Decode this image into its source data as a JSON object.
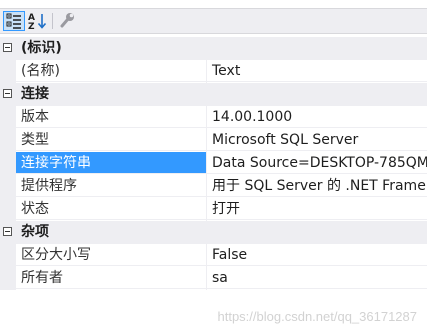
{
  "toolbar": {
    "categorized_icon": "categorized-view-icon",
    "alphabetical_icon": "alphabetical-sort-icon",
    "properties_icon": "wrench-icon"
  },
  "categories": {
    "identity": {
      "label": "(标识)",
      "rows": [
        {
          "name": "(名称)",
          "value": "Text"
        }
      ]
    },
    "connection": {
      "label": "连接",
      "rows": [
        {
          "name": "版本",
          "value": "14.00.1000"
        },
        {
          "name": "类型",
          "value": "Microsoft SQL Server"
        },
        {
          "name": "连接字符串",
          "value": "Data Source=DESKTOP-785QM"
        },
        {
          "name": "提供程序",
          "value": "用于 SQL Server 的 .NET Frame"
        },
        {
          "name": "状态",
          "value": "打开"
        }
      ]
    },
    "misc": {
      "label": "杂项",
      "rows": [
        {
          "name": "区分大小写",
          "value": "False"
        },
        {
          "name": "所有者",
          "value": "sa"
        }
      ]
    }
  },
  "watermark": "https://blog.csdn.net/qq_36171287",
  "colors": {
    "selection": "#3399ff",
    "category_bg": "#eeeef2"
  }
}
